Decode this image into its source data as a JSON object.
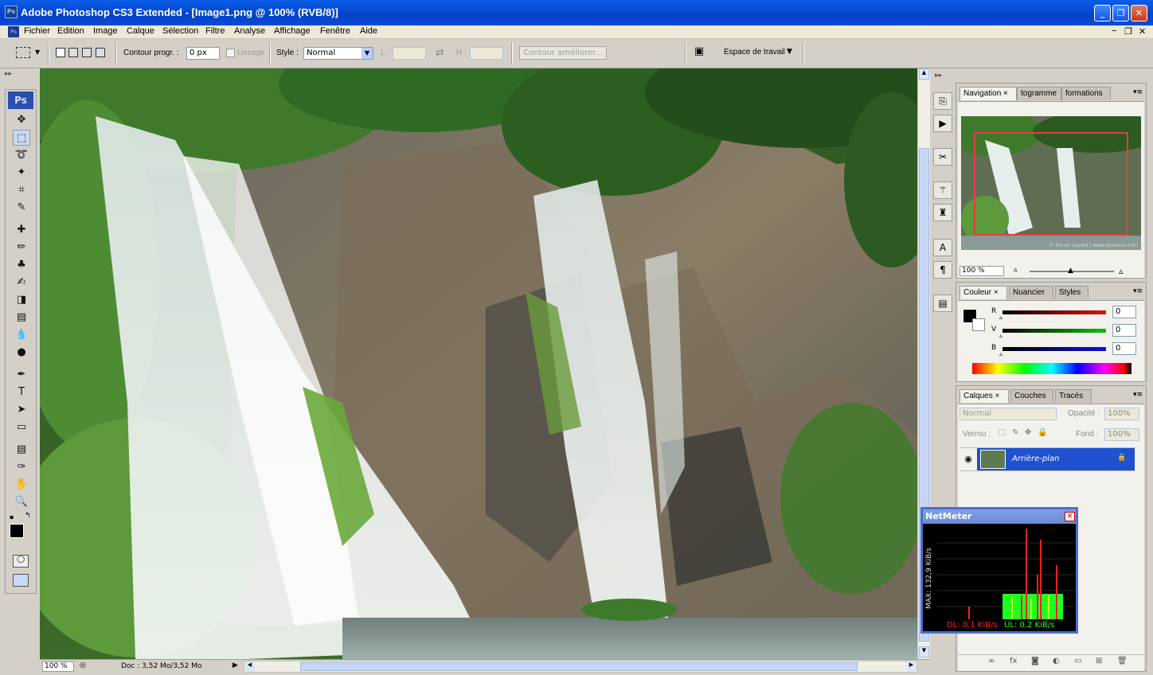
{
  "window": {
    "app_icon": "Ps",
    "title": "Adobe Photoshop CS3 Extended - [Image1.png @ 100% (RVB/8)]",
    "minimize": "_",
    "restore": "❐",
    "close": "✕"
  },
  "menubar": {
    "items": [
      "Fichier",
      "Edition",
      "Image",
      "Calque",
      "Sélection",
      "Filtre",
      "Analyse",
      "Affichage",
      "Fenêtre",
      "Aide"
    ],
    "doc_controls": [
      "−",
      "❐",
      "✕"
    ]
  },
  "options": {
    "feather_label": "Contour progr. :",
    "feather_value": "0 px",
    "antialias_label": "Lissage",
    "style_label": "Style :",
    "style_value": "Normal",
    "width_label": "L :",
    "height_label": "H :",
    "refine_label": "Contour améliorer...",
    "workspace_label": "Espace de travail"
  },
  "toolbox": {
    "logo": "Ps",
    "tools": [
      "move-icon",
      "marquee-icon",
      "lasso-icon",
      "magic-wand-icon",
      "crop-icon",
      "slice-icon",
      "healing-icon",
      "brush-icon",
      "stamp-icon",
      "history-brush-icon",
      "eraser-icon",
      "gradient-icon",
      "blur-icon",
      "dodge-icon",
      "pen-icon",
      "type-icon",
      "path-select-icon",
      "shape-icon",
      "notes-icon",
      "eyedropper-icon",
      "hand-icon",
      "zoom-icon"
    ],
    "glyphs": [
      "✥",
      "⬚",
      "➰",
      "✦",
      "⌗",
      "✎",
      "✚",
      "✏",
      "♣",
      "✍",
      "◨",
      "▤",
      "💧",
      "●",
      "✒",
      "T",
      "➤",
      "▭",
      "▤",
      "✑",
      "✋",
      "🔍"
    ]
  },
  "status": {
    "zoom": "100 %",
    "doc": "Doc : 3,52 Mo/3,52 Mo"
  },
  "navigation": {
    "tabs": [
      "Navigation",
      "togramme",
      "formations"
    ],
    "zoom": "100 %",
    "thumb_caption": "© lire en voyant | www.pluvieux.com"
  },
  "color": {
    "tabs": [
      "Couleur",
      "Nuancier",
      "Styles"
    ],
    "channels": [
      {
        "label": "R",
        "value": "0",
        "color": "#e01010"
      },
      {
        "label": "V",
        "value": "0",
        "color": "#10c010"
      },
      {
        "label": "B",
        "value": "0",
        "color": "#1010e0"
      }
    ]
  },
  "layers": {
    "tabs": [
      "Calques",
      "Couches",
      "Tracés"
    ],
    "blend": "Normal",
    "opacity_label": "Opacité :",
    "opacity": "100%",
    "lock_label": "Verrou :",
    "fill_label": "Fond :",
    "fill": "100%",
    "layer_name": "Arrière-plan",
    "bottom_icons": [
      "link-icon",
      "fx-icon",
      "mask-icon",
      "adjustment-icon",
      "group-icon",
      "new-layer-icon",
      "trash-icon"
    ]
  },
  "netmeter": {
    "title": "NetMeter",
    "max_label": "MAX: 132,9 KiB/s",
    "dl": "DL: 0,1 KiB/s",
    "ul": "UL: 0,2 KiB/s"
  },
  "colors": {
    "accent": "#0a5ee8",
    "layer_selected": "#2150d0",
    "netmeter_dl": "#ff2020",
    "netmeter_ul": "#20ff20"
  }
}
